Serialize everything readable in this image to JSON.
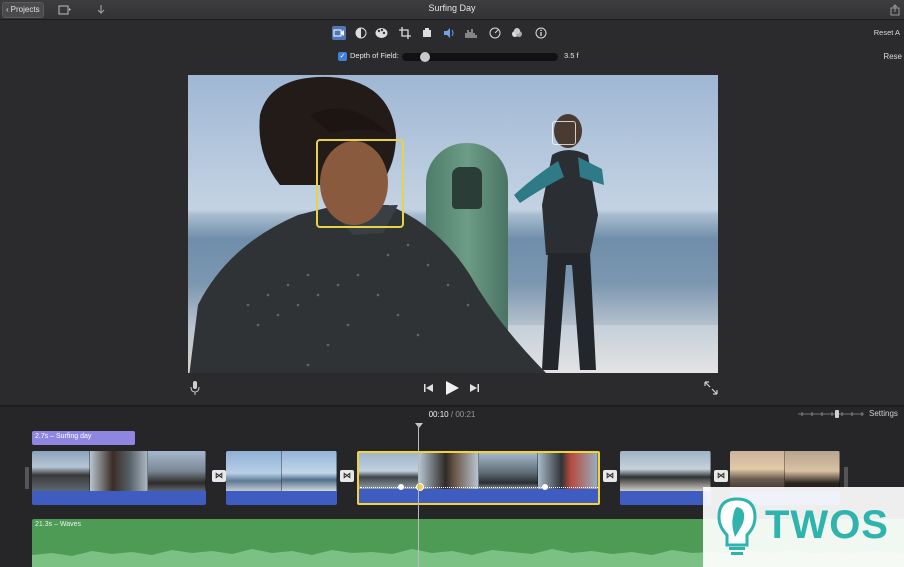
{
  "titlebar": {
    "projects_label": "Projects",
    "title": "Surfing Day"
  },
  "adjust_bar": {
    "tools": [
      "stabilization-icon",
      "color-balance-icon",
      "color-correction-icon",
      "crop-icon",
      "camera-icon",
      "volume-icon",
      "equalizer-icon",
      "speed-icon",
      "noise-reduction-icon",
      "info-icon"
    ],
    "active_tool": "stabilization-icon",
    "reset_all_label": "Reset A",
    "reset_label": "Rese"
  },
  "depth_of_field": {
    "checked": true,
    "label": "Depth of Field:",
    "value": "3.5 f",
    "slider_level": 0.12
  },
  "playback": {
    "current_time": "00:10",
    "separator": "/",
    "total_time": "00:21"
  },
  "timeline": {
    "settings_label": "Settings",
    "title_clip_label": "2.7s – Surfing day",
    "audio_clip_label": "21.3s – Waves"
  },
  "watermark": {
    "text": "TWOS"
  },
  "colors": {
    "accent_blue": "#5078b8",
    "selection_yellow": "#f2d33c",
    "title_clip": "#8e86e0",
    "audio_clip": "#4e9b55",
    "video_audio_strip": "#3f5cc0",
    "watermark_teal": "#2fb3ad"
  }
}
